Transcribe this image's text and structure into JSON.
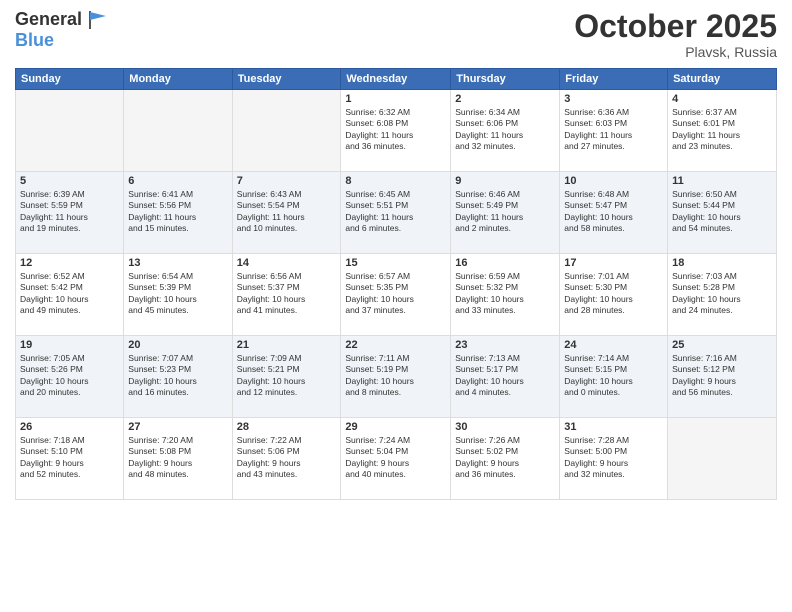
{
  "header": {
    "logo_general": "General",
    "logo_blue": "Blue",
    "month": "October 2025",
    "location": "Plavsk, Russia"
  },
  "days_of_week": [
    "Sunday",
    "Monday",
    "Tuesday",
    "Wednesday",
    "Thursday",
    "Friday",
    "Saturday"
  ],
  "weeks": [
    [
      {
        "day": "",
        "lines": []
      },
      {
        "day": "",
        "lines": []
      },
      {
        "day": "",
        "lines": []
      },
      {
        "day": "1",
        "lines": [
          "Sunrise: 6:32 AM",
          "Sunset: 6:08 PM",
          "Daylight: 11 hours",
          "and 36 minutes."
        ]
      },
      {
        "day": "2",
        "lines": [
          "Sunrise: 6:34 AM",
          "Sunset: 6:06 PM",
          "Daylight: 11 hours",
          "and 32 minutes."
        ]
      },
      {
        "day": "3",
        "lines": [
          "Sunrise: 6:36 AM",
          "Sunset: 6:03 PM",
          "Daylight: 11 hours",
          "and 27 minutes."
        ]
      },
      {
        "day": "4",
        "lines": [
          "Sunrise: 6:37 AM",
          "Sunset: 6:01 PM",
          "Daylight: 11 hours",
          "and 23 minutes."
        ]
      }
    ],
    [
      {
        "day": "5",
        "lines": [
          "Sunrise: 6:39 AM",
          "Sunset: 5:59 PM",
          "Daylight: 11 hours",
          "and 19 minutes."
        ]
      },
      {
        "day": "6",
        "lines": [
          "Sunrise: 6:41 AM",
          "Sunset: 5:56 PM",
          "Daylight: 11 hours",
          "and 15 minutes."
        ]
      },
      {
        "day": "7",
        "lines": [
          "Sunrise: 6:43 AM",
          "Sunset: 5:54 PM",
          "Daylight: 11 hours",
          "and 10 minutes."
        ]
      },
      {
        "day": "8",
        "lines": [
          "Sunrise: 6:45 AM",
          "Sunset: 5:51 PM",
          "Daylight: 11 hours",
          "and 6 minutes."
        ]
      },
      {
        "day": "9",
        "lines": [
          "Sunrise: 6:46 AM",
          "Sunset: 5:49 PM",
          "Daylight: 11 hours",
          "and 2 minutes."
        ]
      },
      {
        "day": "10",
        "lines": [
          "Sunrise: 6:48 AM",
          "Sunset: 5:47 PM",
          "Daylight: 10 hours",
          "and 58 minutes."
        ]
      },
      {
        "day": "11",
        "lines": [
          "Sunrise: 6:50 AM",
          "Sunset: 5:44 PM",
          "Daylight: 10 hours",
          "and 54 minutes."
        ]
      }
    ],
    [
      {
        "day": "12",
        "lines": [
          "Sunrise: 6:52 AM",
          "Sunset: 5:42 PM",
          "Daylight: 10 hours",
          "and 49 minutes."
        ]
      },
      {
        "day": "13",
        "lines": [
          "Sunrise: 6:54 AM",
          "Sunset: 5:39 PM",
          "Daylight: 10 hours",
          "and 45 minutes."
        ]
      },
      {
        "day": "14",
        "lines": [
          "Sunrise: 6:56 AM",
          "Sunset: 5:37 PM",
          "Daylight: 10 hours",
          "and 41 minutes."
        ]
      },
      {
        "day": "15",
        "lines": [
          "Sunrise: 6:57 AM",
          "Sunset: 5:35 PM",
          "Daylight: 10 hours",
          "and 37 minutes."
        ]
      },
      {
        "day": "16",
        "lines": [
          "Sunrise: 6:59 AM",
          "Sunset: 5:32 PM",
          "Daylight: 10 hours",
          "and 33 minutes."
        ]
      },
      {
        "day": "17",
        "lines": [
          "Sunrise: 7:01 AM",
          "Sunset: 5:30 PM",
          "Daylight: 10 hours",
          "and 28 minutes."
        ]
      },
      {
        "day": "18",
        "lines": [
          "Sunrise: 7:03 AM",
          "Sunset: 5:28 PM",
          "Daylight: 10 hours",
          "and 24 minutes."
        ]
      }
    ],
    [
      {
        "day": "19",
        "lines": [
          "Sunrise: 7:05 AM",
          "Sunset: 5:26 PM",
          "Daylight: 10 hours",
          "and 20 minutes."
        ]
      },
      {
        "day": "20",
        "lines": [
          "Sunrise: 7:07 AM",
          "Sunset: 5:23 PM",
          "Daylight: 10 hours",
          "and 16 minutes."
        ]
      },
      {
        "day": "21",
        "lines": [
          "Sunrise: 7:09 AM",
          "Sunset: 5:21 PM",
          "Daylight: 10 hours",
          "and 12 minutes."
        ]
      },
      {
        "day": "22",
        "lines": [
          "Sunrise: 7:11 AM",
          "Sunset: 5:19 PM",
          "Daylight: 10 hours",
          "and 8 minutes."
        ]
      },
      {
        "day": "23",
        "lines": [
          "Sunrise: 7:13 AM",
          "Sunset: 5:17 PM",
          "Daylight: 10 hours",
          "and 4 minutes."
        ]
      },
      {
        "day": "24",
        "lines": [
          "Sunrise: 7:14 AM",
          "Sunset: 5:15 PM",
          "Daylight: 10 hours",
          "and 0 minutes."
        ]
      },
      {
        "day": "25",
        "lines": [
          "Sunrise: 7:16 AM",
          "Sunset: 5:12 PM",
          "Daylight: 9 hours",
          "and 56 minutes."
        ]
      }
    ],
    [
      {
        "day": "26",
        "lines": [
          "Sunrise: 7:18 AM",
          "Sunset: 5:10 PM",
          "Daylight: 9 hours",
          "and 52 minutes."
        ]
      },
      {
        "day": "27",
        "lines": [
          "Sunrise: 7:20 AM",
          "Sunset: 5:08 PM",
          "Daylight: 9 hours",
          "and 48 minutes."
        ]
      },
      {
        "day": "28",
        "lines": [
          "Sunrise: 7:22 AM",
          "Sunset: 5:06 PM",
          "Daylight: 9 hours",
          "and 43 minutes."
        ]
      },
      {
        "day": "29",
        "lines": [
          "Sunrise: 7:24 AM",
          "Sunset: 5:04 PM",
          "Daylight: 9 hours",
          "and 40 minutes."
        ]
      },
      {
        "day": "30",
        "lines": [
          "Sunrise: 7:26 AM",
          "Sunset: 5:02 PM",
          "Daylight: 9 hours",
          "and 36 minutes."
        ]
      },
      {
        "day": "31",
        "lines": [
          "Sunrise: 7:28 AM",
          "Sunset: 5:00 PM",
          "Daylight: 9 hours",
          "and 32 minutes."
        ]
      },
      {
        "day": "",
        "lines": []
      }
    ]
  ]
}
